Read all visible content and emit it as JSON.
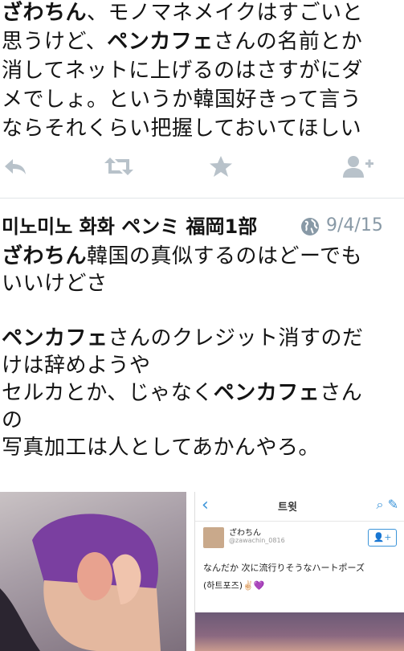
{
  "tweet1": {
    "lines": [
      {
        "bold": "ざわちん",
        "rest": "、モノマネメイクはすごいと"
      },
      {
        "bold": "",
        "rest": "思うけど、"
      },
      {
        "bold": "",
        "rest": "消してネットに上げるのはさすがにダ"
      },
      {
        "bold": "",
        "rest": "メでしょ。というか韓国好きって言う"
      },
      {
        "bold": "",
        "rest": "ならそれくらい把握しておいてほしい"
      }
    ],
    "line2_bold": "ペンカフェ",
    "line2_tail": "さんの名前とか",
    "actions": [
      "reply-icon",
      "retweet-icon",
      "favorite-icon",
      "follow-icon"
    ]
  },
  "tweet2": {
    "name": "미노미노 화화 ペンミ 福岡1部",
    "date": "9/4/15",
    "p1_bold": "ざわちん",
    "p1_rest": "韓国の真似するのはどーでも",
    "p1_line2": "いいけどさ",
    "p2_bold": "ペンカフェ",
    "p2_rest": "さんのクレジット消すのだ",
    "p2_line2": "けは辞めようや",
    "p3_start": "セルカとか、じゃなく",
    "p3_bold": "ペンカフェ",
    "p3_rest": "さん",
    "p3_line2": "の",
    "p4": "写真加工は人としてあかんやろ。"
  },
  "screenshot_embed": {
    "title": "트윗",
    "user_name": "ざわちん",
    "user_handle": "@zawachin_0816",
    "text": "なんだか 次に流行りそうなハートポーズ",
    "text2": "(하트포즈)✌🏻💜"
  },
  "colors": {
    "icon": "#b8c2ca",
    "date": "#8899a6",
    "accent": "#3b94d9"
  }
}
